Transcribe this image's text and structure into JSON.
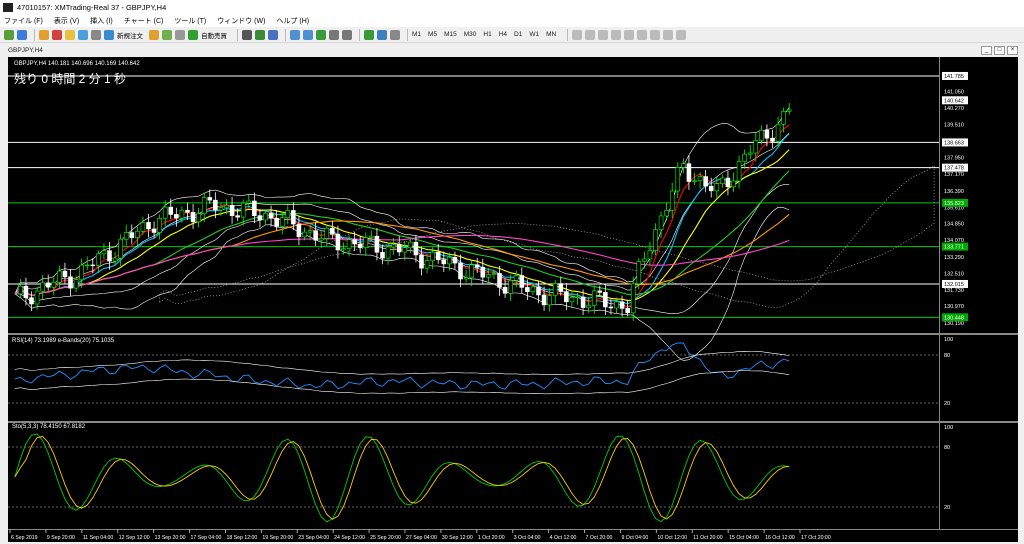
{
  "window": {
    "title": "47010157: XMTrading-Real 37 - GBPJPY,H4"
  },
  "menu": [
    "ファイル (F)",
    "表示 (V)",
    "挿入 (I)",
    "チャート (C)",
    "ツール (T)",
    "ウィンドウ (W)",
    "ヘルプ (H)"
  ],
  "toolbar": {
    "new_order": "新規注文",
    "autotrade": "自動売買",
    "timeframes": [
      "M1",
      "M5",
      "M15",
      "M30",
      "H1",
      "H4",
      "D1",
      "W1",
      "MN"
    ]
  },
  "chart_window": {
    "title": "GBPJPY,H4",
    "controls": {
      "minimize": "_",
      "restore": "□",
      "close": "×"
    }
  },
  "main_chart": {
    "header": "GBPJPY,H4  140.181 140.696 140.169 140.642",
    "countdown": "残り 0 時間 2 分 1 秒",
    "price_labels": [
      "141.050",
      "140.270",
      "139.510",
      "137.950",
      "137.170",
      "136.390",
      "135.610",
      "134.850",
      "134.070",
      "133.290",
      "132.510",
      "131.730",
      "130.970",
      "130.190"
    ],
    "price_boxes": [
      {
        "text": "141.785",
        "type": "line"
      },
      {
        "text": "140.642",
        "type": "current"
      },
      {
        "text": "138.663",
        "type": "line"
      },
      {
        "text": "137.478",
        "type": "line"
      },
      {
        "text": "135.823",
        "type": "green"
      },
      {
        "text": "133.771",
        "type": "green"
      },
      {
        "text": "132.015",
        "type": "line"
      },
      {
        "text": "130.448",
        "type": "green"
      }
    ],
    "colors": {
      "bull": "#00ff00",
      "bear": "#ffffff",
      "ma_fast": "#ff0000",
      "ma_yellow": "#ffff00",
      "ma_cyan": "#00bfff",
      "ma_green": "#22cc22",
      "ma_orange": "#ff9900",
      "ma_magenta": "#ff44cc",
      "bands": "#ffffff",
      "cloud": "#bbbbbb"
    }
  },
  "rsi_panel": {
    "header": "RSI(14) 73.1989  e-Bands(20) 75.1035",
    "levels": [
      "80",
      "20"
    ],
    "scale_max": "100",
    "scale_min": "0"
  },
  "stoch_panel": {
    "header": "Sto(5,3,3) 78.4150 67.8182",
    "levels": [
      "80",
      "20"
    ],
    "scale_max": "100",
    "scale_min": "0"
  },
  "time_axis": [
    "6 Sep 2019",
    "9 Sep 20:00",
    "11 Sep 04:00",
    "12 Sep 12:00",
    "13 Sep 20:00",
    "17 Sep 04:00",
    "18 Sep 12:00",
    "19 Sep 20:00",
    "23 Sep 04:00",
    "24 Sep 12:00",
    "25 Sep 20:00",
    "27 Sep 04:00",
    "30 Sep 12:00",
    "1 Oct 20:00",
    "3 Oct 04:00",
    "4 Oct 12:00",
    "7 Oct 20:00",
    "9 Oct 04:00",
    "10 Oct 12:00",
    "11 Oct 20:00",
    "15 Oct 04:00",
    "16 Oct 12:00",
    "17 Oct 20:00"
  ]
}
